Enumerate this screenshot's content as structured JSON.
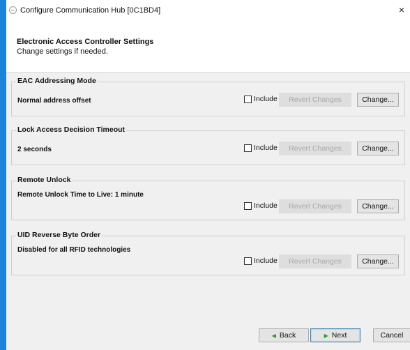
{
  "window": {
    "title": "Configure Communication Hub [0C1BD4]",
    "close_glyph": "×"
  },
  "header": {
    "title": "Electronic Access Controller Settings",
    "subtitle": "Change settings if needed."
  },
  "groups": [
    {
      "legend": "EAC Addressing Mode",
      "value": "Normal address offset",
      "include_label": "Include",
      "include_checked": false,
      "revert_label": "Revert Changes",
      "change_label": "Change..."
    },
    {
      "legend": "Lock Access Decision Timeout",
      "value": "2 seconds",
      "include_label": "Include",
      "include_checked": false,
      "revert_label": "Revert Changes",
      "change_label": "Change..."
    },
    {
      "legend": "Remote Unlock",
      "value": "Remote Unlock Time to Live: 1 minute",
      "include_label": "Include",
      "include_checked": false,
      "revert_label": "Revert Changes",
      "change_label": "Change..."
    },
    {
      "legend": "UID Reverse Byte Order",
      "value": "Disabled for all RFID technologies",
      "include_label": "Include",
      "include_checked": false,
      "revert_label": "Revert Changes",
      "change_label": "Change..."
    }
  ],
  "footer": {
    "back_label": "Back",
    "next_label": "Next",
    "cancel_label": "Cancel"
  },
  "colors": {
    "window_border": "#1b84d8",
    "content_bg": "#f0f0f0",
    "nav_arrow": "#2a9a2a"
  }
}
